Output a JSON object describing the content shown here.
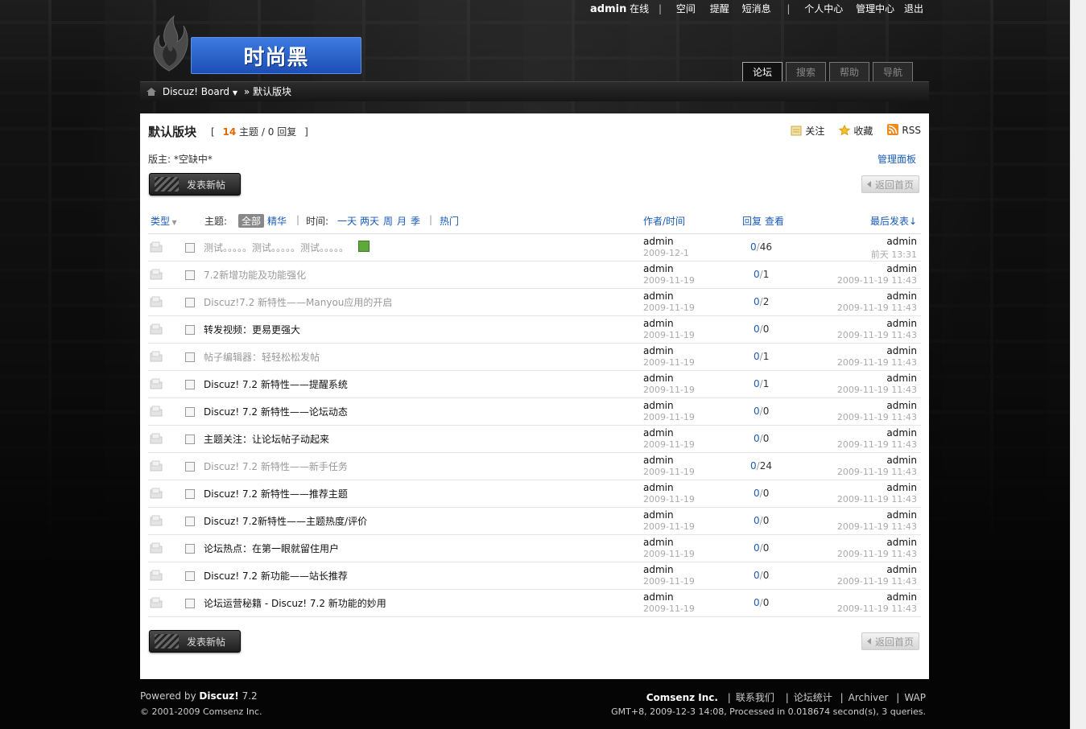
{
  "topnav": {
    "user": "admin",
    "status": "在线",
    "space": "空间",
    "remind": "提醒",
    "pm": "短消息",
    "profile": "个人中心",
    "admin_center": "管理中心",
    "logout": "退出"
  },
  "logo": {
    "text": "时尚黑"
  },
  "tabs": [
    "论坛",
    "搜索",
    "帮助",
    "导航"
  ],
  "breadcrumb": {
    "board": "Discuz! Board",
    "forum": "» 默认版块"
  },
  "forum": {
    "title": "默认版块",
    "bracket_open": "[",
    "topics_count": "14",
    "topics_label": "主题",
    "sep": "/",
    "replies_count": "0",
    "replies_label": "回复",
    "bracket_close": "]",
    "moderator": "版主: *空缺中*",
    "manage_panel": "管理面板",
    "follow": "关注",
    "favorite": "收藏",
    "rss": "RSS",
    "new_post": "发表新帖",
    "back_home": "返回首页"
  },
  "table_header": {
    "type": "类型",
    "subject_label": "主题:",
    "all": "全部",
    "digest": "精华",
    "time_label": "时间:",
    "day": "一天",
    "two_days": "两天",
    "week": "周",
    "month": "月",
    "season": "季",
    "hot": "热门",
    "author_time": "作者/时间",
    "reply": "回复",
    "view": "查看",
    "last_post": "最后发表↓"
  },
  "threads": [
    {
      "subject": "测试。。。。。测试。。。。。测试。。。。。",
      "style": "gray",
      "author": "admin",
      "date": "2009-12-1",
      "replies": "0",
      "views": "46",
      "last_author": "admin",
      "last_date": "前天 13:31",
      "has_image": true
    },
    {
      "subject": "7.2新增功能及功能强化",
      "style": "gray",
      "author": "admin",
      "date": "2009-11-19",
      "replies": "0",
      "views": "1",
      "last_author": "admin",
      "last_date": "2009-11-19 11:43"
    },
    {
      "subject": "Discuz!7.2 新特性——Manyou应用的开启",
      "style": "gray",
      "author": "admin",
      "date": "2009-11-19",
      "replies": "0",
      "views": "2",
      "last_author": "admin",
      "last_date": "2009-11-19 11:43"
    },
    {
      "subject": "转发视频：更易更强大",
      "style": "dark",
      "author": "admin",
      "date": "2009-11-19",
      "replies": "0",
      "views": "0",
      "last_author": "admin",
      "last_date": "2009-11-19 11:43"
    },
    {
      "subject": "帖子编辑器：轻轻松松发帖",
      "style": "gray",
      "author": "admin",
      "date": "2009-11-19",
      "replies": "0",
      "views": "1",
      "last_author": "admin",
      "last_date": "2009-11-19 11:43"
    },
    {
      "subject": "Discuz! 7.2 新特性——提醒系统",
      "style": "dark",
      "author": "admin",
      "date": "2009-11-19",
      "replies": "0",
      "views": "1",
      "last_author": "admin",
      "last_date": "2009-11-19 11:43"
    },
    {
      "subject": "Discuz! 7.2 新特性——论坛动态",
      "style": "dark",
      "author": "admin",
      "date": "2009-11-19",
      "replies": "0",
      "views": "0",
      "last_author": "admin",
      "last_date": "2009-11-19 11:43"
    },
    {
      "subject": "主题关注：让论坛帖子动起来",
      "style": "dark",
      "author": "admin",
      "date": "2009-11-19",
      "replies": "0",
      "views": "0",
      "last_author": "admin",
      "last_date": "2009-11-19 11:43"
    },
    {
      "subject": "Discuz! 7.2 新特性——新手任务",
      "style": "gray",
      "author": "admin",
      "date": "2009-11-19",
      "replies": "0",
      "views": "24",
      "last_author": "admin",
      "last_date": "2009-11-19 11:43"
    },
    {
      "subject": "Discuz! 7.2 新特性——推荐主题",
      "style": "dark",
      "author": "admin",
      "date": "2009-11-19",
      "replies": "0",
      "views": "0",
      "last_author": "admin",
      "last_date": "2009-11-19 11:43"
    },
    {
      "subject": "Discuz! 7.2新特性——主题热度/评价",
      "style": "dark",
      "author": "admin",
      "date": "2009-11-19",
      "replies": "0",
      "views": "0",
      "last_author": "admin",
      "last_date": "2009-11-19 11:43"
    },
    {
      "subject": "论坛热点：在第一眼就留住用户",
      "style": "dark",
      "author": "admin",
      "date": "2009-11-19",
      "replies": "0",
      "views": "0",
      "last_author": "admin",
      "last_date": "2009-11-19 11:43"
    },
    {
      "subject": "Discuz! 7.2 新功能——站长推荐",
      "style": "dark",
      "author": "admin",
      "date": "2009-11-19",
      "replies": "0",
      "views": "0",
      "last_author": "admin",
      "last_date": "2009-11-19 11:43"
    },
    {
      "subject": "论坛运营秘籍 - Discuz! 7.2 新功能的妙用",
      "style": "dark",
      "author": "admin",
      "date": "2009-11-19",
      "replies": "0",
      "views": "0",
      "last_author": "admin",
      "last_date": "2009-11-19 11:43"
    }
  ],
  "footer": {
    "powered": "Powered by",
    "brand": "Discuz!",
    "version": "7.2",
    "copyright": "© 2001-2009 Comsenz Inc.",
    "company": "Comsenz Inc.",
    "contact": "联系我们",
    "stats": "论坛统计",
    "archiver": "Archiver",
    "wap": "WAP",
    "processed": "GMT+8, 2009-12-3 14:08, Processed in 0.018674 second(s), 3 queries."
  },
  "colors": {
    "accent_blue": "#1a5bb8",
    "topic_count_orange": "#e06a00",
    "logo_blue": "#2a5fc8"
  }
}
